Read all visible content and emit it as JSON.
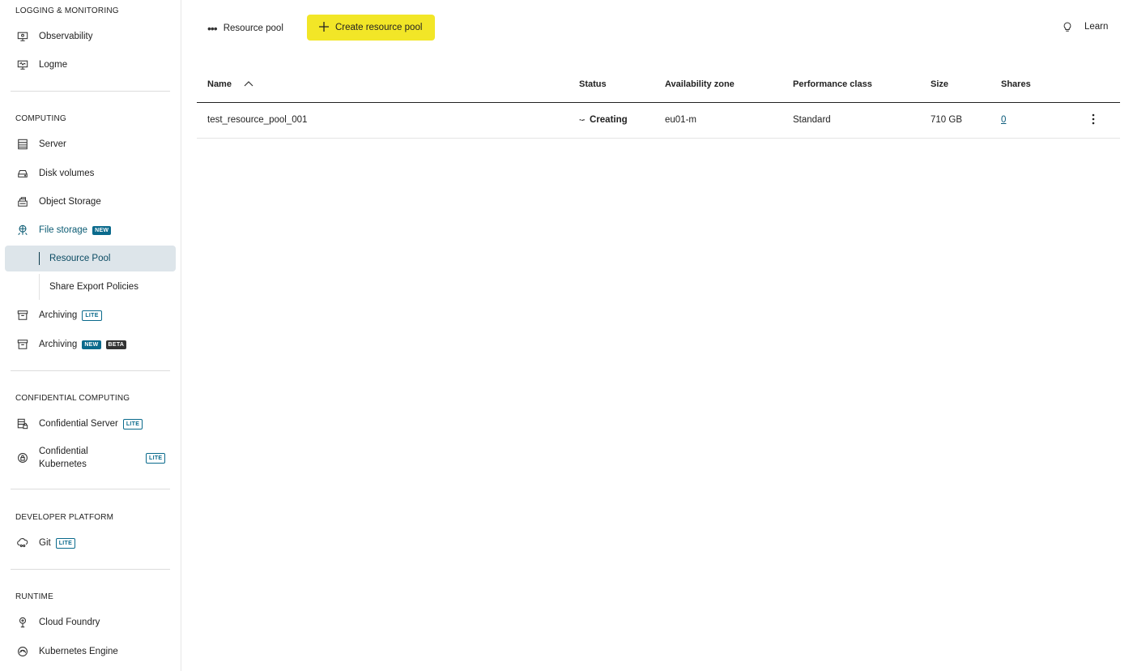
{
  "sidebar": {
    "sections": [
      {
        "title": "LOGGING & MONITORING"
      },
      {
        "title": "COMPUTING"
      },
      {
        "title": "CONFIDENTIAL COMPUTING"
      },
      {
        "title": "DEVELOPER PLATFORM"
      },
      {
        "title": "RUNTIME"
      }
    ],
    "items": {
      "observability": {
        "label": "Observability",
        "icon": "monitor-icon"
      },
      "logme": {
        "label": "Logme",
        "icon": "monitor-log-icon"
      },
      "server": {
        "label": "Server",
        "icon": "server-icon"
      },
      "disk_volumes": {
        "label": "Disk volumes",
        "icon": "disk-icon"
      },
      "object_storage": {
        "label": "Object Storage",
        "icon": "bucket-icon"
      },
      "file_storage": {
        "label": "File storage",
        "icon": "file-storage-icon",
        "badge": "NEW"
      },
      "resource_pool": {
        "label": "Resource Pool"
      },
      "share_export_policies": {
        "label": "Share Export Policies"
      },
      "archiving_lite": {
        "label": "Archiving",
        "icon": "archive-icon",
        "badge": "LITE"
      },
      "archiving_new": {
        "label": "Archiving",
        "icon": "archive-icon",
        "badge1": "NEW",
        "badge2": "BETA"
      },
      "confidential_server": {
        "label": "Confidential Server",
        "icon": "secure-server-icon",
        "badge": "LITE"
      },
      "confidential_kubernetes_line1": "Confidential",
      "confidential_kubernetes_line2": "Kubernetes",
      "confidential_kubernetes_badge": "LITE",
      "git": {
        "label": "Git",
        "icon": "git-icon",
        "badge": "LITE"
      },
      "cloud_foundry": {
        "label": "Cloud Foundry",
        "icon": "cloud-foundry-icon"
      },
      "kubernetes_engine": {
        "label": "Kubernetes Engine",
        "icon": "kubernetes-icon"
      }
    }
  },
  "toolbar": {
    "more_label": "Resource pool",
    "create_label": "Create resource pool",
    "learn_label": "Learn"
  },
  "table": {
    "headers": {
      "name": "Name",
      "status": "Status",
      "availability_zone": "Availability zone",
      "performance_class": "Performance class",
      "size": "Size",
      "shares": "Shares"
    },
    "rows": [
      {
        "name": "test_resource_pool_001",
        "status": "Creating",
        "availability_zone": "eu01-m",
        "performance_class": "Standard",
        "size": "710 GB",
        "shares": "0"
      }
    ]
  },
  "colors": {
    "accent_yellow": "#f2e627",
    "teal": "#0a6a8c",
    "active_bg": "#dde5ea"
  }
}
